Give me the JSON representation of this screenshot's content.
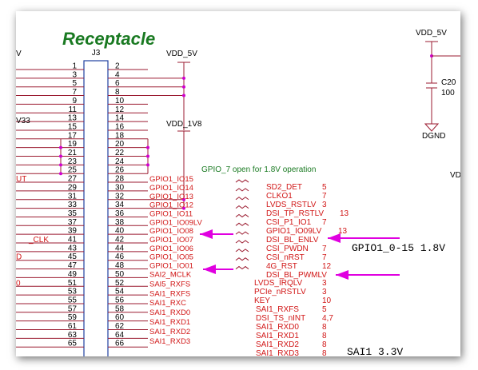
{
  "title": "Receptacle",
  "connector": {
    "ref": "J3",
    "left_pins": [
      "1",
      "3",
      "5",
      "7",
      "9",
      "11",
      "13",
      "15",
      "17",
      "19",
      "21",
      "23",
      "25",
      "27",
      "29",
      "31",
      "33",
      "35",
      "37",
      "39",
      "41",
      "43",
      "45",
      "47",
      "49",
      "51",
      "53",
      "55",
      "57",
      "59",
      "61",
      "63",
      "65"
    ],
    "right_pins": [
      "2",
      "4",
      "6",
      "8",
      "10",
      "12",
      "14",
      "16",
      "18",
      "20",
      "22",
      "24",
      "26",
      "28",
      "30",
      "32",
      "34",
      "36",
      "38",
      "40",
      "42",
      "44",
      "46",
      "48",
      "50",
      "52",
      "54",
      "56",
      "58",
      "60",
      "62",
      "64",
      "66"
    ]
  },
  "power": {
    "vdd_5v_a": "VDD_5V",
    "vdd_1v8": "VDD_1V8",
    "vdd_5v_b": "VDD_5V",
    "dgnd": "DGND",
    "cap_ref": "C20",
    "cap_value": "100",
    "vd_fragment": "VD",
    "v33_fragment": "V33",
    "v_fragment": "V"
  },
  "note_gpio7": "GPIO_7 open for 1.8V operation",
  "left_edge_labels": {
    "pin27": "UT",
    "pin49": "_CLK",
    "pin53": "D",
    "pin59": "0"
  },
  "gpio_nets": [
    "GPIO1_IO15",
    "GPIO1_IO14",
    "GPIO1_IO13",
    "GPIO1_IO12",
    "GPIO1_IO11",
    "GPIO1_IO09LV",
    "GPIO1_IO08",
    "GPIO1_IO07",
    "GPIO1_IO06",
    "GPIO1_IO05",
    "GPIO1_IO01"
  ],
  "sai_nets": [
    "SAI2_MCLK",
    "SAI5_RXFS",
    "SAI1_RXFS",
    "SAI1_RXC",
    "SAI1_RXD0",
    "SAI1_RXD1",
    "SAI1_RXD2",
    "SAI1_RXD3"
  ],
  "functions": [
    {
      "name": "SD2_DET",
      "ref": "5"
    },
    {
      "name": "CLKO1",
      "ref": "7"
    },
    {
      "name": "LVDS_RSTLV",
      "ref": "3"
    },
    {
      "name": "DSI_TP_RSTLV",
      "ref": "13"
    },
    {
      "name": "CSI_P1_IO1",
      "ref": "7"
    },
    {
      "name": "GPIO1_IO09LV",
      "ref": "13"
    },
    {
      "name": "DSI_BL_ENLV",
      "ref": ""
    },
    {
      "name": "CSI_PWDN",
      "ref": "7"
    },
    {
      "name": "CSI_nRST",
      "ref": "7"
    },
    {
      "name": "4G_RST",
      "ref": "12"
    },
    {
      "name": "DSI_BL_PWMLV",
      "ref": ""
    }
  ],
  "lower_functions": [
    {
      "name": "LVDS_IRQLV",
      "ref": "3"
    },
    {
      "name": "PCIe_nRSTLV",
      "ref": "3"
    },
    {
      "name": "KEY",
      "ref": "10"
    },
    {
      "name": "SAI1_RXFS",
      "ref": "5"
    },
    {
      "name": "DSI_TS_nINT",
      "ref": "4,7"
    },
    {
      "name": "SAI1_RXD0",
      "ref": "8"
    },
    {
      "name": "SAI1_RXD1",
      "ref": "8"
    },
    {
      "name": "SAI1_RXD2",
      "ref": "8"
    },
    {
      "name": "SAI1_RXD3",
      "ref": "8"
    }
  ],
  "annotation_gpio": "GPIO1_0-15 1.8V",
  "annotation_sai": "SAI1 3.3V",
  "colors": {
    "wire": "#9b1b30",
    "net": "#d11616",
    "arrow": "#e000e0",
    "junction": "#d000d0",
    "title": "#1a7a22"
  }
}
